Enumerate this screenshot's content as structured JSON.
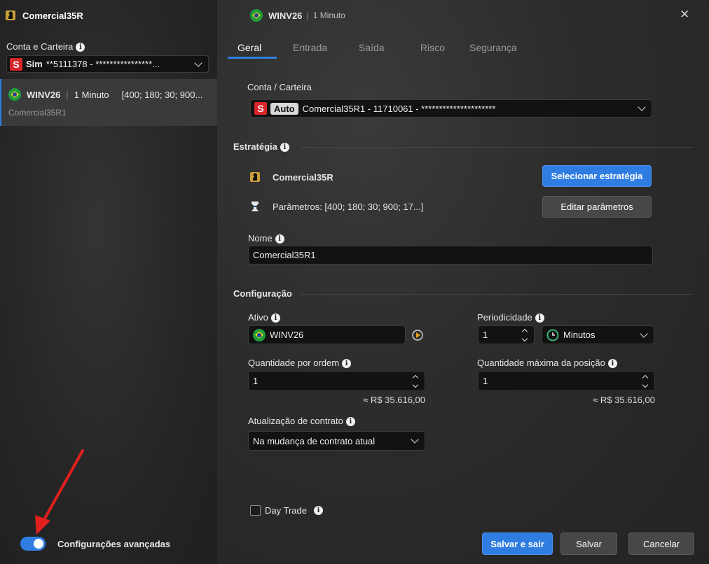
{
  "sidebar": {
    "strategy_title": "Comercial35R",
    "account_label": "Conta e Carteira",
    "account_badge": "S",
    "account_value_bold": "Sim",
    "account_value": "**5111378 - ****************...",
    "item": {
      "symbol": "WINV26",
      "period": "1 Minuto",
      "params": "[400; 180; 30; 900...",
      "name": "Comercial35R1"
    },
    "advanced_label": "Configurações avançadas",
    "advanced_on": true
  },
  "header": {
    "symbol": "WINV26",
    "period": "1 Minuto",
    "close_glyph": "✕"
  },
  "tabs": [
    "Geral",
    "Entrada",
    "Saída",
    "Risco",
    "Segurança"
  ],
  "conta": {
    "label": "Conta / Carteira",
    "badge": "S",
    "mode": "Auto",
    "value": "Comercial35R1 - 11710061 - *********************"
  },
  "estrategia": {
    "section": "Estratégia",
    "name": "Comercial35R",
    "params": "Parâmetros: [400; 180; 30; 900; 17...]",
    "select_button": "Selecionar estratégia",
    "edit_button": "Editar parâmetros",
    "nome_label": "Nome",
    "nome_value": "Comercial35R1"
  },
  "configuracao": {
    "section": "Configuração",
    "ativo_label": "Ativo",
    "ativo_value": "WINV26",
    "periodicidade_label": "Periodicidade",
    "periodicidade_value": "1",
    "periodicidade_unit": "Minutos",
    "qtd_label": "Quantidade por ordem",
    "qtd_value": "1",
    "qtd_approx": "≈ R$ 35.616,00",
    "qtd_max_label": "Quantidade máxima da posição",
    "qtd_max_value": "1",
    "qtd_max_approx": "≈ R$ 35.616,00",
    "atualizacao_label": "Atualização de contrato",
    "atualizacao_value": "Na mudança de contrato atual",
    "daytrade_label": "Day Trade",
    "daytrade_checked": false
  },
  "footer": {
    "save_exit": "Salvar e sair",
    "save": "Salvar",
    "cancel": "Cancelar"
  },
  "colors": {
    "accent": "#2f7de1",
    "badge_red": "#d9262c",
    "annotation_arrow": "#e0201c"
  }
}
